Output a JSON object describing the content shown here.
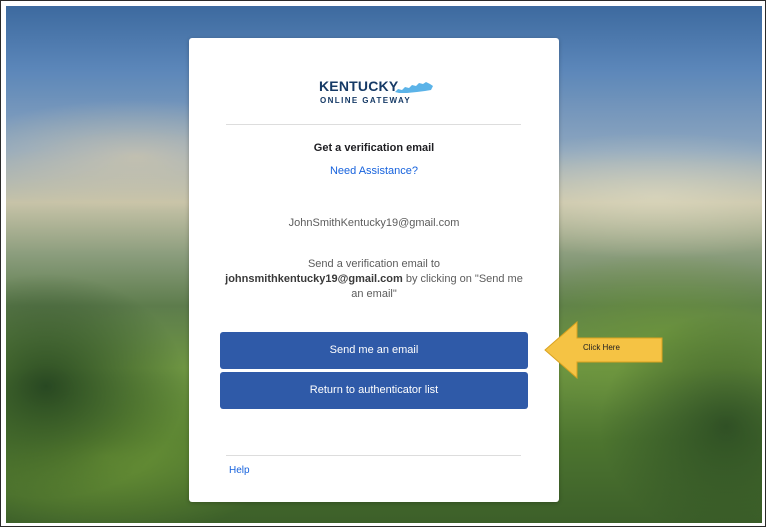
{
  "logo": {
    "title": "KENTUCKY",
    "subtitle": "ONLINE GATEWAY"
  },
  "card": {
    "title": "Get a verification email",
    "assist_link": "Need Assistance?",
    "email": "JohnSmithKentucky19@gmail.com",
    "desc_before": "Send a verification email to",
    "desc_email": "johnsmithkentucky19@gmail.com",
    "desc_after": " by clicking on \"Send me an email\"",
    "send_button": "Send me an email",
    "return_button": "Return to authenticator list",
    "help_link": "Help"
  },
  "annotation": {
    "label": "Click Here"
  },
  "colors": {
    "button": "#2f5aa8",
    "link": "#1662dd",
    "brand_navy": "#163a66",
    "brand_sky": "#5bb3e8",
    "callout": "#f5c344"
  },
  "icons": {
    "state_shape": "kentucky-state-icon",
    "callout_arrow": "arrow-left-icon"
  }
}
